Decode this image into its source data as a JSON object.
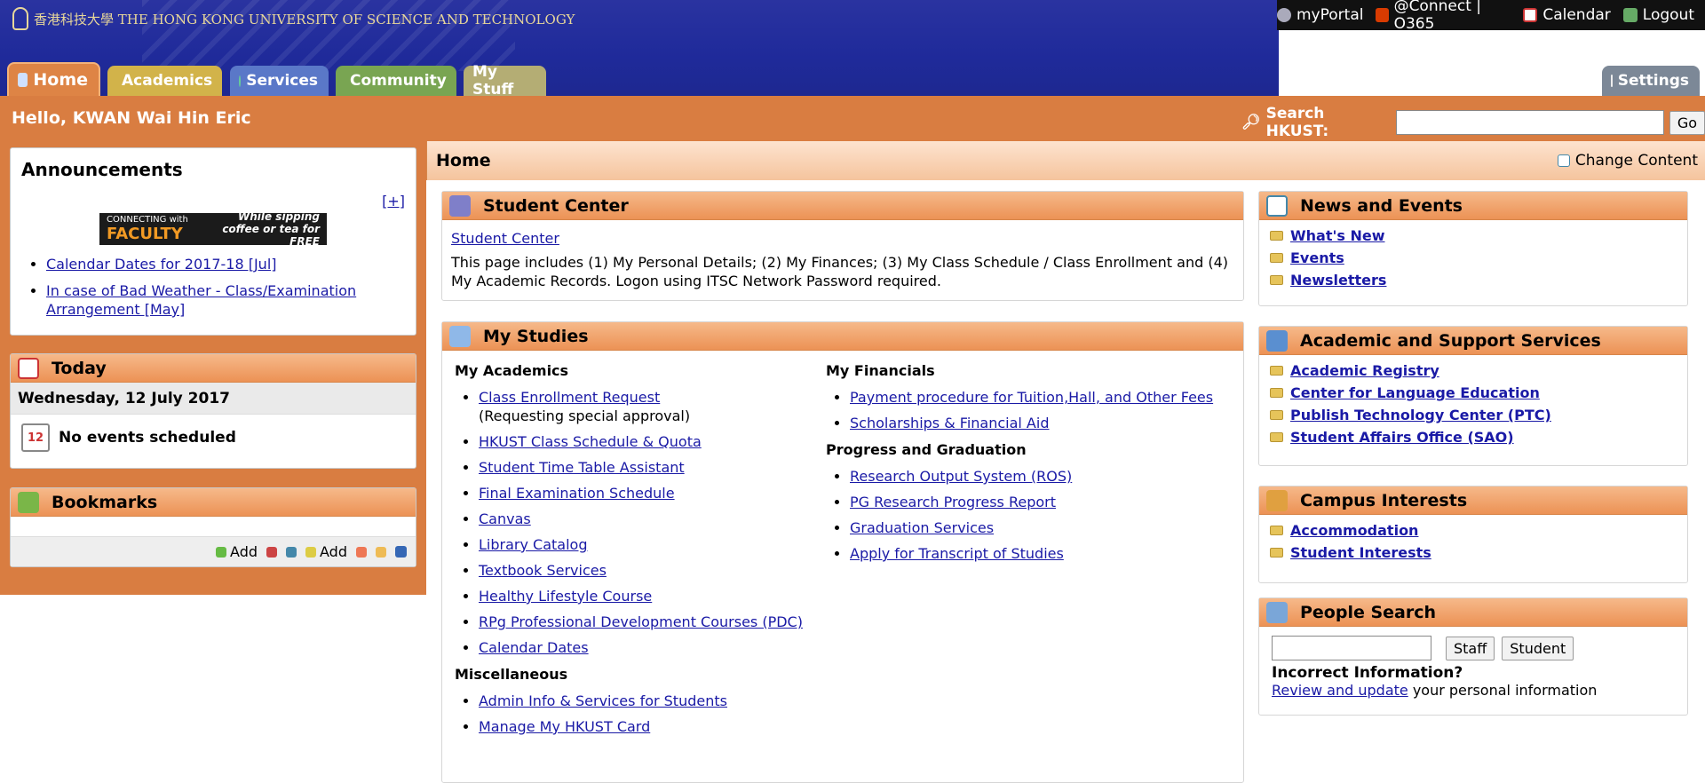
{
  "banner": {
    "university": "香港科技大學  THE HONG KONG UNIVERSITY OF SCIENCE AND TECHNOLOGY"
  },
  "utility": {
    "myportal": "myPortal",
    "connect": "@Connect | O365",
    "calendar": "Calendar",
    "logout": "Logout"
  },
  "tabs": {
    "home": "Home",
    "academics": "Academics",
    "services": "Services",
    "community": "Community",
    "mystuff": "My Stuff",
    "settings": "Settings"
  },
  "greeting": "Hello, KWAN Wai Hin Eric",
  "search": {
    "label": "Search HKUST:",
    "value": "",
    "go": "Go"
  },
  "announcements": {
    "title": "Announcements",
    "expand": "[+]",
    "promo": {
      "line1": "CONNECTING with",
      "line2": "FACULTY",
      "line3": "While sipping coffee or tea for FREE"
    },
    "items": [
      "Calendar Dates for 2017-18 [Jul]",
      "In case of Bad Weather - Class/Examination Arrangement [May]"
    ]
  },
  "today": {
    "title": "Today",
    "date": "Wednesday, 12 July 2017",
    "cal_day": "12",
    "no_events": "No events scheduled"
  },
  "bookmarks": {
    "title": "Bookmarks",
    "add1": "Add",
    "add2": "Add"
  },
  "main": {
    "title": "Home",
    "change_content": "Change Content"
  },
  "student_center": {
    "title": "Student Center",
    "link": "Student Center",
    "desc": "This page includes (1) My Personal Details; (2) My Finances; (3) My Class Schedule / Class Enrollment and (4) My Academic Records. Logon using ITSC Network Password required."
  },
  "my_studies": {
    "title": "My Studies",
    "academics_heading": "My Academics",
    "academics": [
      "Class Enrollment Request",
      "HKUST Class Schedule & Quota",
      "Student Time Table Assistant",
      "Final Examination Schedule",
      "Canvas",
      "Library Catalog",
      "Textbook Services",
      "Healthy Lifestyle Course",
      "RPg Professional Development Courses (PDC)",
      "Calendar Dates"
    ],
    "academics_note": "(Requesting special approval)",
    "misc_heading": "Miscellaneous",
    "misc": [
      "Admin Info & Services for Students",
      "Manage My HKUST Card"
    ],
    "financials_heading": "My Financials",
    "financials": [
      "Payment procedure for Tuition,Hall, and Other Fees",
      "Scholarships & Financial Aid"
    ],
    "progress_heading": "Progress and Graduation",
    "progress": [
      "Research Output System (ROS)",
      "PG Research Progress Report",
      "Graduation Services",
      "Apply for Transcript of Studies"
    ]
  },
  "news": {
    "title": "News and Events",
    "items": [
      "What's New",
      "Events",
      "Newsletters"
    ]
  },
  "academic_services": {
    "title": "Academic and Support Services",
    "items": [
      "Academic Registry",
      "Center for Language Education",
      "Publish Technology Center (PTC)",
      "Student Affairs Office (SAO)"
    ]
  },
  "campus": {
    "title": "Campus Interests",
    "items": [
      "Accommodation",
      "Student Interests"
    ]
  },
  "people": {
    "title": "People Search",
    "staff": "Staff",
    "student": "Student",
    "incorrect": "Incorrect Information?",
    "review_link": "Review and update",
    "review_rest": " your personal information"
  },
  "colors": {
    "banner": "#1f2a9a",
    "orange": "#d97d41",
    "header_grad": "#ec9255",
    "link": "#1a1aa6"
  }
}
